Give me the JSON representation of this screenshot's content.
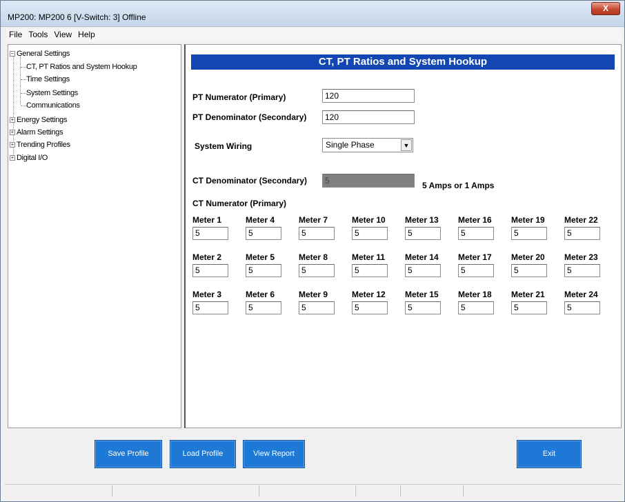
{
  "window": {
    "title": "MP200: MP200 6 [V-Switch: 3] Offline",
    "close_label": "X"
  },
  "menu": [
    "File",
    "Tools",
    "View",
    "Help"
  ],
  "tree": {
    "general": "General Settings",
    "ct_pt": "CT, PT Ratios and System Hookup",
    "time": "Time Settings",
    "system": "System Settings",
    "comms": "Communications",
    "energy": "Energy Settings",
    "alarm": "Alarm Settings",
    "trending": "Trending Profiles",
    "digital": "Digital I/O",
    "expanded_symbol": "⊟",
    "collapsed_symbol": "⊞"
  },
  "form": {
    "banner": "CT, PT Ratios and System Hookup",
    "pt_numerator_label": "PT Numerator (Primary)",
    "pt_numerator_value": "120",
    "pt_denominator_label": "PT Denominator (Secondary)",
    "pt_denominator_value": "120",
    "wiring_label": "System Wiring",
    "wiring_value": "Single Phase",
    "ct_denominator_label": "CT Denominator (Secondary)",
    "ct_denominator_value": "5",
    "ct_denominator_note": "5 Amps or 1 Amps",
    "ct_numerator_label": "CT Numerator (Primary)",
    "meters": [
      [
        {
          "label": "Meter 1",
          "value": "5"
        },
        {
          "label": "Meter 4",
          "value": "5"
        },
        {
          "label": "Meter 7",
          "value": "5"
        },
        {
          "label": "Meter 10",
          "value": "5"
        },
        {
          "label": "Meter 13",
          "value": "5"
        },
        {
          "label": "Meter 16",
          "value": "5"
        },
        {
          "label": "Meter 19",
          "value": "5"
        },
        {
          "label": "Meter 22",
          "value": "5"
        }
      ],
      [
        {
          "label": "Meter 2",
          "value": "5"
        },
        {
          "label": "Meter 5",
          "value": "5"
        },
        {
          "label": "Meter 8",
          "value": "5"
        },
        {
          "label": "Meter 11",
          "value": "5"
        },
        {
          "label": "Meter 14",
          "value": "5"
        },
        {
          "label": "Meter 17",
          "value": "5"
        },
        {
          "label": "Meter 20",
          "value": "5"
        },
        {
          "label": "Meter 23",
          "value": "5"
        }
      ],
      [
        {
          "label": "Meter 3",
          "value": "5"
        },
        {
          "label": "Meter 6",
          "value": "5"
        },
        {
          "label": "Meter 9",
          "value": "5"
        },
        {
          "label": "Meter 12",
          "value": "5"
        },
        {
          "label": "Meter 15",
          "value": "5"
        },
        {
          "label": "Meter 18",
          "value": "5"
        },
        {
          "label": "Meter 21",
          "value": "5"
        },
        {
          "label": "Meter 24",
          "value": "5"
        }
      ]
    ]
  },
  "buttons": {
    "save": "Save Profile",
    "load": "Load Profile",
    "report": "View Report",
    "exit": "Exit"
  },
  "colors": {
    "banner": "#1146b3",
    "button": "#1d78d6",
    "disabled_field": "#808080"
  }
}
